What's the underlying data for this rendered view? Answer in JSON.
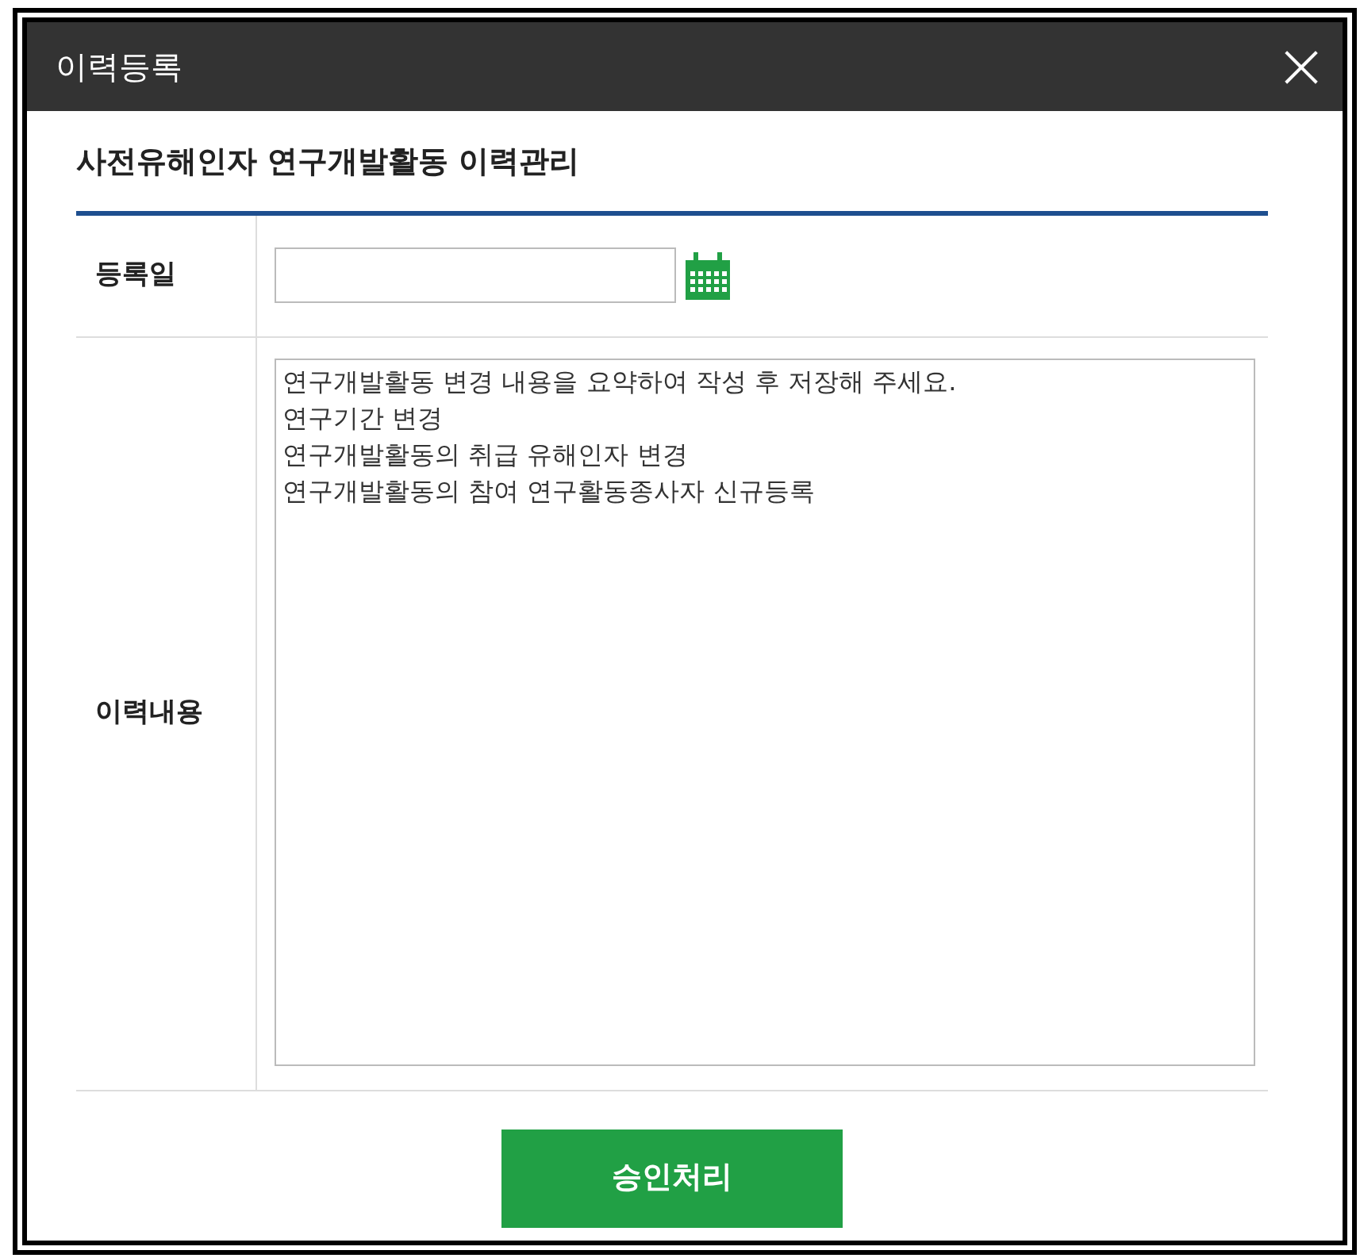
{
  "window": {
    "title": "이력등록",
    "close": "×"
  },
  "heading": "사전유해인자 연구개발활동 이력관리",
  "form": {
    "date": {
      "label": "등록일"
    },
    "content": {
      "label": "이력내용",
      "value": "연구개발활동 변경 내용을 요약하여 작성 후 저장해 주세요.\n연구기간 변경\n연구개발활동의 취급 유해인자 변경\n연구개발활동의 참여 연구활동종사자 신규등록"
    }
  },
  "buttons": [
    "승인처리"
  ]
}
